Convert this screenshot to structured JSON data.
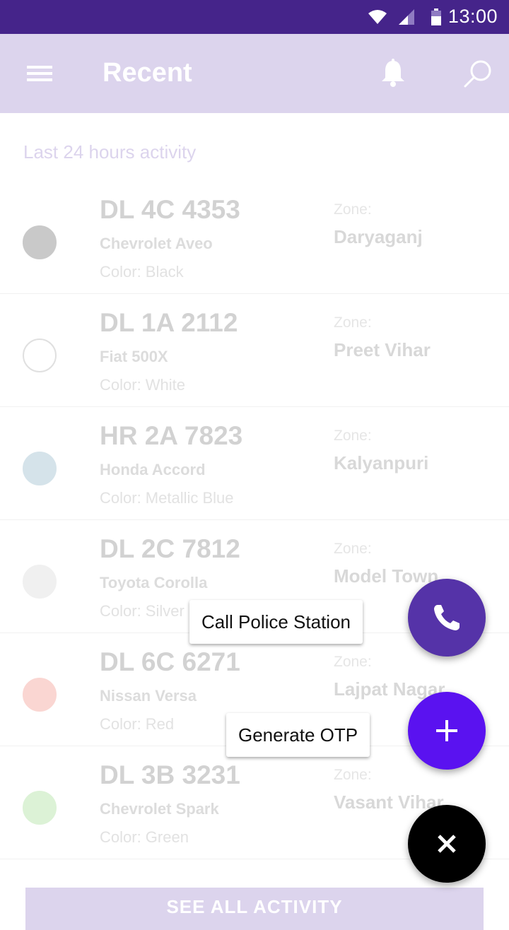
{
  "status_bar": {
    "time": "13:00",
    "icons": [
      "wifi-icon",
      "signal-icon",
      "battery-icon"
    ]
  },
  "app_bar": {
    "title": "Recent",
    "icons": [
      "menu-icon",
      "bell-icon",
      "search-icon"
    ]
  },
  "subheader": "Last 24 hours activity",
  "vehicles": [
    {
      "plate": "DL 4C 4353",
      "model": "Chevrolet Aveo",
      "color": "Color: Black",
      "zone_label": "Zone:",
      "zone": "Daryaganj",
      "swatch": "#c9c9c9",
      "swatch_border": "#c9c9c9"
    },
    {
      "plate": "DL 1A 2112",
      "model": "Fiat 500X",
      "color": "Color: White",
      "zone_label": "Zone:",
      "zone": "Preet Vihar",
      "swatch": "#ffffff",
      "swatch_border": "#e0e0e0"
    },
    {
      "plate": "HR 2A 7823",
      "model": "Honda Accord",
      "color": "Color: Metallic Blue",
      "zone_label": "Zone:",
      "zone": "Kalyanpuri",
      "swatch": "#d5e3ea",
      "swatch_border": "#d5e3ea"
    },
    {
      "plate": "DL 2C 7812",
      "model": "Toyota Corolla",
      "color": "Color: Silver",
      "zone_label": "Zone:",
      "zone": "Model Town",
      "swatch": "#f0f0f0",
      "swatch_border": "#f0f0f0"
    },
    {
      "plate": "DL 6C 6271",
      "model": "Nissan Versa",
      "color": "Color: Red",
      "zone_label": "Zone:",
      "zone": "Lajpat Nagar",
      "swatch": "#fad6d2",
      "swatch_border": "#fad6d2"
    },
    {
      "plate": "DL 3B 3231",
      "model": "Chevrolet Spark",
      "color": "Color: Green",
      "zone_label": "Zone:",
      "zone": "Vasant Vihar",
      "swatch": "#dcf2d6",
      "swatch_border": "#dcf2d6"
    }
  ],
  "see_all_label": "SEE ALL ACTIVITY",
  "speed_dial": {
    "call_label": "Call Police Station",
    "otp_label": "Generate OTP",
    "call_icon": "phone-icon",
    "otp_icon": "plus-icon",
    "close_icon": "close-icon"
  },
  "colors": {
    "status_bar": "#45248a",
    "app_bar": "#dcd4ed",
    "fab_call": "#5533a8",
    "fab_otp": "#5a12f0",
    "fab_close": "#000000"
  }
}
